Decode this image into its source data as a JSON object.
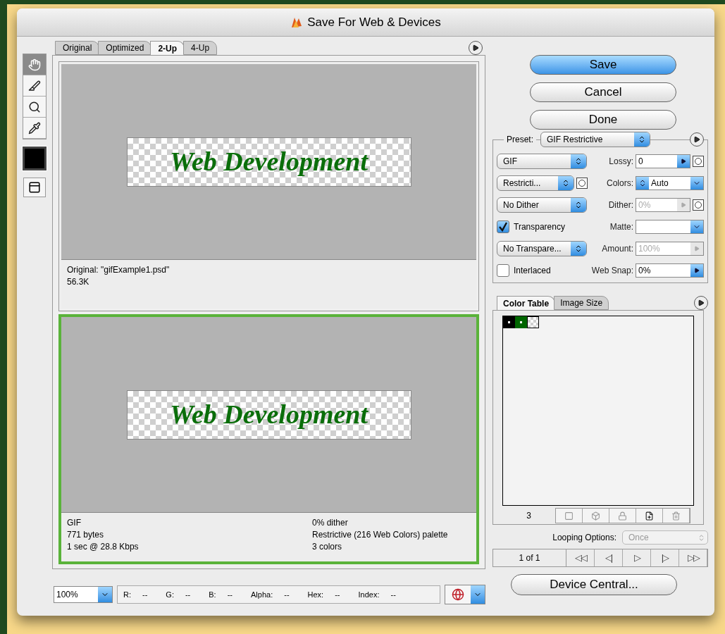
{
  "window": {
    "title": "Save For Web & Devices"
  },
  "view_tabs": [
    {
      "label": "Original",
      "selected": false
    },
    {
      "label": "Optimized",
      "selected": false
    },
    {
      "label": "2-Up",
      "selected": true
    },
    {
      "label": "4-Up",
      "selected": false
    }
  ],
  "tools": [
    {
      "kind": "hand",
      "selected": true
    },
    {
      "kind": "slice",
      "selected": false
    },
    {
      "kind": "zoom",
      "selected": false
    },
    {
      "kind": "eyedropper",
      "selected": false
    }
  ],
  "panes": [
    {
      "selected": false,
      "artwork_text": "Web Development",
      "info_left": [
        "Original: \"gifExample1.psd\"",
        "56.3K"
      ]
    },
    {
      "selected": true,
      "artwork_text": "Web Development",
      "info_left": [
        "GIF",
        "771 bytes",
        "1 sec @ 28.8 Kbps"
      ],
      "info_right": [
        "0% dither",
        "Restrictive (216 Web Colors) palette",
        "3 colors"
      ]
    }
  ],
  "buttons": [
    {
      "label": "Save",
      "default": true
    },
    {
      "label": "Cancel",
      "default": false
    },
    {
      "label": "Done",
      "default": false
    }
  ],
  "settings": {
    "preset_label": "Preset:",
    "preset": "GIF Restrictive",
    "left": [
      {
        "kind": "select",
        "value": "GIF",
        "mask": false
      },
      {
        "kind": "select",
        "value": "Restricti...",
        "mask": true
      },
      {
        "kind": "select",
        "value": "No Dither",
        "mask": false
      },
      {
        "kind": "checkbox",
        "label": "Transparency",
        "checked": true
      },
      {
        "kind": "select",
        "value": "No Transpare...",
        "mask": false
      },
      {
        "kind": "checkbox",
        "label": "Interlaced",
        "checked": false
      }
    ],
    "right": [
      {
        "kind": "slider",
        "label": "Lossy:",
        "value": "0",
        "disabled": false,
        "mask": true
      },
      {
        "kind": "stepper",
        "label": "Colors:",
        "value": "Auto",
        "disabled": false,
        "mask": false
      },
      {
        "kind": "slider",
        "label": "Dither:",
        "value": "0%",
        "disabled": true,
        "mask": true
      },
      {
        "kind": "combo",
        "label": "Matte:",
        "disabled": false,
        "mask": false
      },
      {
        "kind": "slider",
        "label": "Amount:",
        "value": "100%",
        "disabled": true,
        "mask": false
      },
      {
        "kind": "slider",
        "label": "Web Snap:",
        "value": "0%",
        "disabled": false,
        "mask": false
      }
    ]
  },
  "panel_tabs": [
    {
      "label": "Color Table",
      "selected": true
    },
    {
      "label": "Image Size",
      "selected": false
    }
  ],
  "swatches": [
    {
      "color": "#000000",
      "kind": "solid"
    },
    {
      "color": "#006600",
      "kind": "solid"
    },
    {
      "kind": "transparent"
    }
  ],
  "color_count": "3",
  "looping": {
    "label": "Looping Options:",
    "value": "Once"
  },
  "frame": {
    "counter": "1 of 1",
    "controls": [
      "◁◁",
      "◁|",
      "▷",
      "|▷",
      "▷▷"
    ]
  },
  "device_central": "Device Central...",
  "zoom": "100%",
  "readouts": [
    {
      "label": "R:",
      "value": "--"
    },
    {
      "label": "G:",
      "value": "--"
    },
    {
      "label": "B:",
      "value": "--"
    },
    {
      "label": "Alpha:",
      "value": "--"
    },
    {
      "label": "Hex:",
      "value": "--"
    },
    {
      "label": "Index:",
      "value": "--"
    }
  ]
}
